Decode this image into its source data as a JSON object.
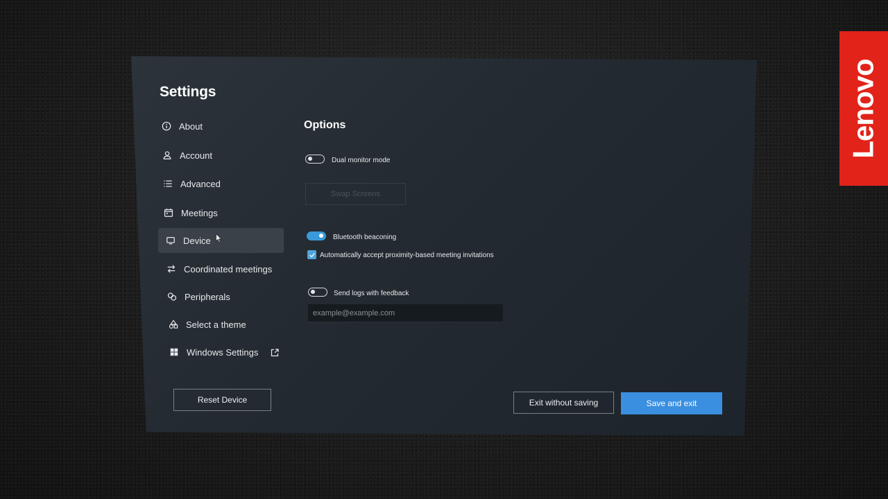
{
  "brand": {
    "logo_text": "Lenovo",
    "color": "#e2231a"
  },
  "settings": {
    "title": "Settings",
    "nav": [
      {
        "label": "About",
        "icon": "info-icon"
      },
      {
        "label": "Account",
        "icon": "user-icon"
      },
      {
        "label": "Advanced",
        "icon": "list-icon"
      },
      {
        "label": "Meetings",
        "icon": "calendar-icon"
      },
      {
        "label": "Device",
        "icon": "monitor-icon",
        "active": true
      },
      {
        "label": "Coordinated meetings",
        "icon": "swap-arrows-icon"
      },
      {
        "label": "Peripherals",
        "icon": "peripherals-icon"
      },
      {
        "label": "Select a theme",
        "icon": "theme-icon"
      },
      {
        "label": "Windows Settings",
        "icon": "windows-icon",
        "external": true
      }
    ],
    "reset_button": "Reset Device"
  },
  "options": {
    "title": "Options",
    "dual_monitor": {
      "label": "Dual monitor mode",
      "enabled": false
    },
    "swap_screens_button": "Swap Screens",
    "bluetooth_beaconing": {
      "label": "Bluetooth beaconing",
      "enabled": true
    },
    "auto_accept": {
      "label": "Automatically accept proximity-based meeting invitations",
      "checked": true
    },
    "send_logs": {
      "label": "Send logs with feedback",
      "enabled": false
    },
    "email_placeholder": "example@example.com"
  },
  "footer": {
    "exit_without_saving": "Exit without saving",
    "save_and_exit": "Save and exit"
  },
  "colors": {
    "accent": "#3a8fe0",
    "toggle_on": "#3a9ad9",
    "panel_bg": "#232a31"
  }
}
